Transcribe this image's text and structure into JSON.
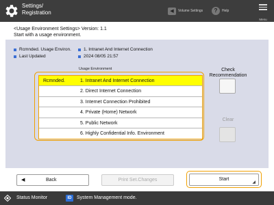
{
  "topbar": {
    "title_line1": "Settings/",
    "title_line2": "Registration",
    "volume_label": "Volume Settings",
    "help_label": "Help",
    "menu_label": "Menu"
  },
  "header": {
    "line1": "<Usage Environment Settings> Version: 1.1",
    "line2": "Start with a usage environment."
  },
  "meta": {
    "rec_label": "Rcmnded. Usage Environ.",
    "rec_value": "1. Intranet And Internet Connection",
    "updated_label": "Last Updated",
    "updated_value": "2024 08/05 21:57"
  },
  "environment": {
    "heading": "Usage Environment",
    "recommended_tag": "Rcmnded.",
    "items": [
      {
        "label": "1. Intranet And Internet Connection"
      },
      {
        "label": "2. Direct Internet Connection"
      },
      {
        "label": "3. Internet Connection Prohibited"
      },
      {
        "label": "4. Private (Home) Network"
      },
      {
        "label": "5. Public Network"
      },
      {
        "label": "6. Highly Confidential Info. Environment"
      }
    ]
  },
  "side": {
    "check_line1": "Check",
    "check_line2": "Recommendation",
    "clear_label": "Clear"
  },
  "buttons": {
    "back": "Back",
    "print": "Print Set.Changes",
    "start": "Start"
  },
  "statusbar": {
    "status_monitor": "Status Monitor",
    "id_badge": "ID",
    "system_mode": "System Management mode."
  },
  "colors": {
    "accent_orange": "#f0a000",
    "selected_row": "#ffff00",
    "panel_bg": "#d9dbe8",
    "bar_bg": "#3d3d3d"
  }
}
